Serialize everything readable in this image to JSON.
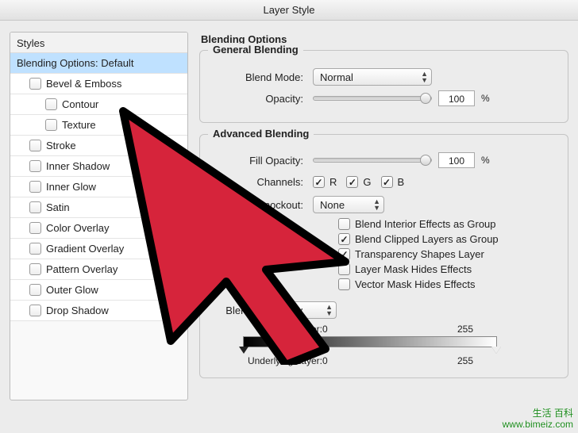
{
  "window_title": "Layer Style",
  "styles_panel": {
    "header": "Styles",
    "items": [
      {
        "label": "Blending Options: Default",
        "checkbox": false,
        "indent": 0,
        "selected": true
      },
      {
        "label": "Bevel & Emboss",
        "checkbox": true,
        "indent": 1
      },
      {
        "label": "Contour",
        "checkbox": true,
        "indent": 2
      },
      {
        "label": "Texture",
        "checkbox": true,
        "indent": 2
      },
      {
        "label": "Stroke",
        "checkbox": true,
        "indent": 1
      },
      {
        "label": "Inner Shadow",
        "checkbox": true,
        "indent": 1
      },
      {
        "label": "Inner Glow",
        "checkbox": true,
        "indent": 1
      },
      {
        "label": "Satin",
        "checkbox": true,
        "indent": 1
      },
      {
        "label": "Color Overlay",
        "checkbox": true,
        "indent": 1
      },
      {
        "label": "Gradient Overlay",
        "checkbox": true,
        "indent": 1
      },
      {
        "label": "Pattern Overlay",
        "checkbox": true,
        "indent": 1
      },
      {
        "label": "Outer Glow",
        "checkbox": true,
        "indent": 1
      },
      {
        "label": "Drop Shadow",
        "checkbox": true,
        "indent": 1
      }
    ]
  },
  "options_title": "Blending Options",
  "general": {
    "heading": "General Blending",
    "blend_mode_label": "Blend Mode:",
    "blend_mode_value": "Normal",
    "opacity_label": "Opacity:",
    "opacity_value": "100",
    "pct": "%"
  },
  "advanced": {
    "heading": "Advanced Blending",
    "fill_opacity_label": "Fill Opacity:",
    "fill_opacity_value": "100",
    "pct": "%",
    "channels_label": "Channels:",
    "channels": {
      "r": "R",
      "g": "G",
      "b": "B"
    },
    "knockout_label": "Knockout:",
    "knockout_value": "None",
    "checks": {
      "interior": "Blend Interior Effects as Group",
      "clipped": "Blend Clipped Layers as Group",
      "transparency": "Transparency Shapes Layer",
      "layer_mask": "Layer Mask Hides Effects",
      "vector_mask": "Vector Mask Hides Effects"
    },
    "blend_if_label": "Blend If:",
    "blend_if_value": "Gray",
    "this_layer_label": "This Layer:",
    "this_layer_lo": "0",
    "this_layer_hi": "255",
    "under_layer_label": "Underlying Layer:",
    "under_layer_lo": "0",
    "under_layer_hi": "255"
  },
  "watermark": {
    "line1": "生活 百科",
    "line2": "www.bimeiz.com"
  }
}
